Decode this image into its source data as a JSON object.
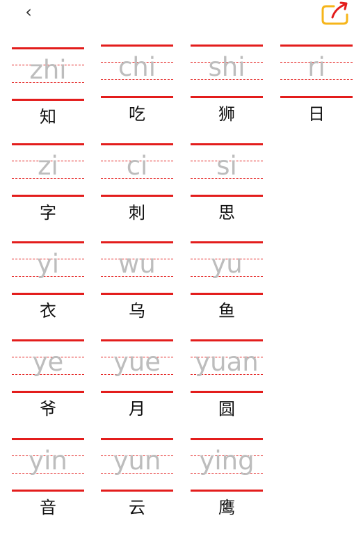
{
  "header": {
    "back_label": "‹",
    "share_icon": "share-icon",
    "share_color": "#f6b51a"
  },
  "theme": {
    "line_color": "#e31d1c",
    "pinyin_color": "#bdbdbd"
  },
  "cards": [
    {
      "pinyin": "zhi",
      "hanzi": "知"
    },
    {
      "pinyin": "chi",
      "hanzi": "吃"
    },
    {
      "pinyin": "shi",
      "hanzi": "狮"
    },
    {
      "pinyin": "ri",
      "hanzi": "日"
    },
    {
      "pinyin": "zi",
      "hanzi": "字"
    },
    {
      "pinyin": "ci",
      "hanzi": "刺"
    },
    {
      "pinyin": "si",
      "hanzi": "思"
    },
    {
      "pinyin": "yi",
      "hanzi": "衣"
    },
    {
      "pinyin": "wu",
      "hanzi": "乌"
    },
    {
      "pinyin": "yu",
      "hanzi": "鱼"
    },
    {
      "pinyin": "ye",
      "hanzi": "爷"
    },
    {
      "pinyin": "yue",
      "hanzi": "月"
    },
    {
      "pinyin": "yuan",
      "hanzi": "圆"
    },
    {
      "pinyin": "yin",
      "hanzi": "音"
    },
    {
      "pinyin": "yun",
      "hanzi": "云"
    },
    {
      "pinyin": "ying",
      "hanzi": "鹰"
    }
  ]
}
